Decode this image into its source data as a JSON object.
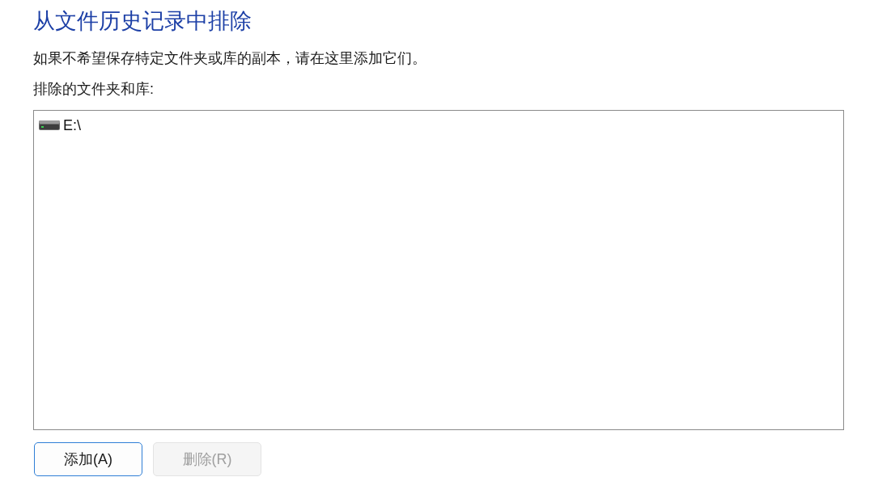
{
  "title": "从文件历史记录中排除",
  "description": "如果不希望保存特定文件夹或库的副本，请在这里添加它们。",
  "excluded_list": {
    "label": "排除的文件夹和库:",
    "items": [
      {
        "label": "E:\\",
        "selected": false
      }
    ]
  },
  "buttons": [
    {
      "label": "添加(A)",
      "default": true,
      "disabled": false
    },
    {
      "label": "删除(R)",
      "default": false,
      "disabled": true
    }
  ]
}
